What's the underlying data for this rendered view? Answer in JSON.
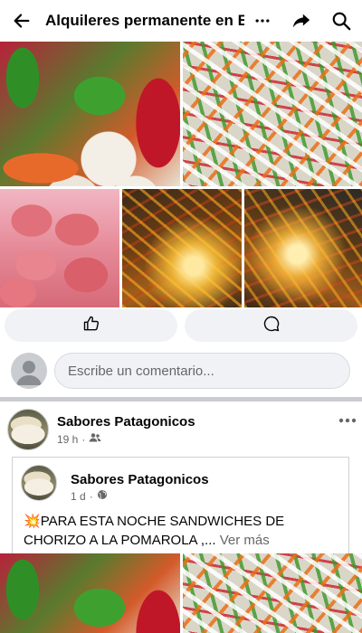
{
  "header": {
    "title": "Alquileres permanente en E...",
    "icons": [
      "back-arrow-icon",
      "more-dots-icon",
      "share-icon",
      "search-icon"
    ]
  },
  "colors": {
    "background": "#ffffff",
    "button_bg": "#f0f2f5",
    "secondary_text": "#65676b",
    "divider": "#c9ccd1"
  },
  "actions": {
    "like_icon": "thumbs-up-icon",
    "comment_icon": "comment-bubble-icon"
  },
  "comment": {
    "placeholder": "Escribe un comentario..."
  },
  "post": {
    "author": "Sabores Patagonicos",
    "time": "19 h",
    "audience_icon": "friends-icon",
    "shared": {
      "author": "Sabores Patagonicos",
      "time": "1 d",
      "audience_icon": "globe-icon",
      "emoji": "💥",
      "text": "PARA ESTA NOCHE SANDWICHES DE CHORIZO A LA POMAROLA ,...",
      "see_more": " Ver más"
    }
  }
}
